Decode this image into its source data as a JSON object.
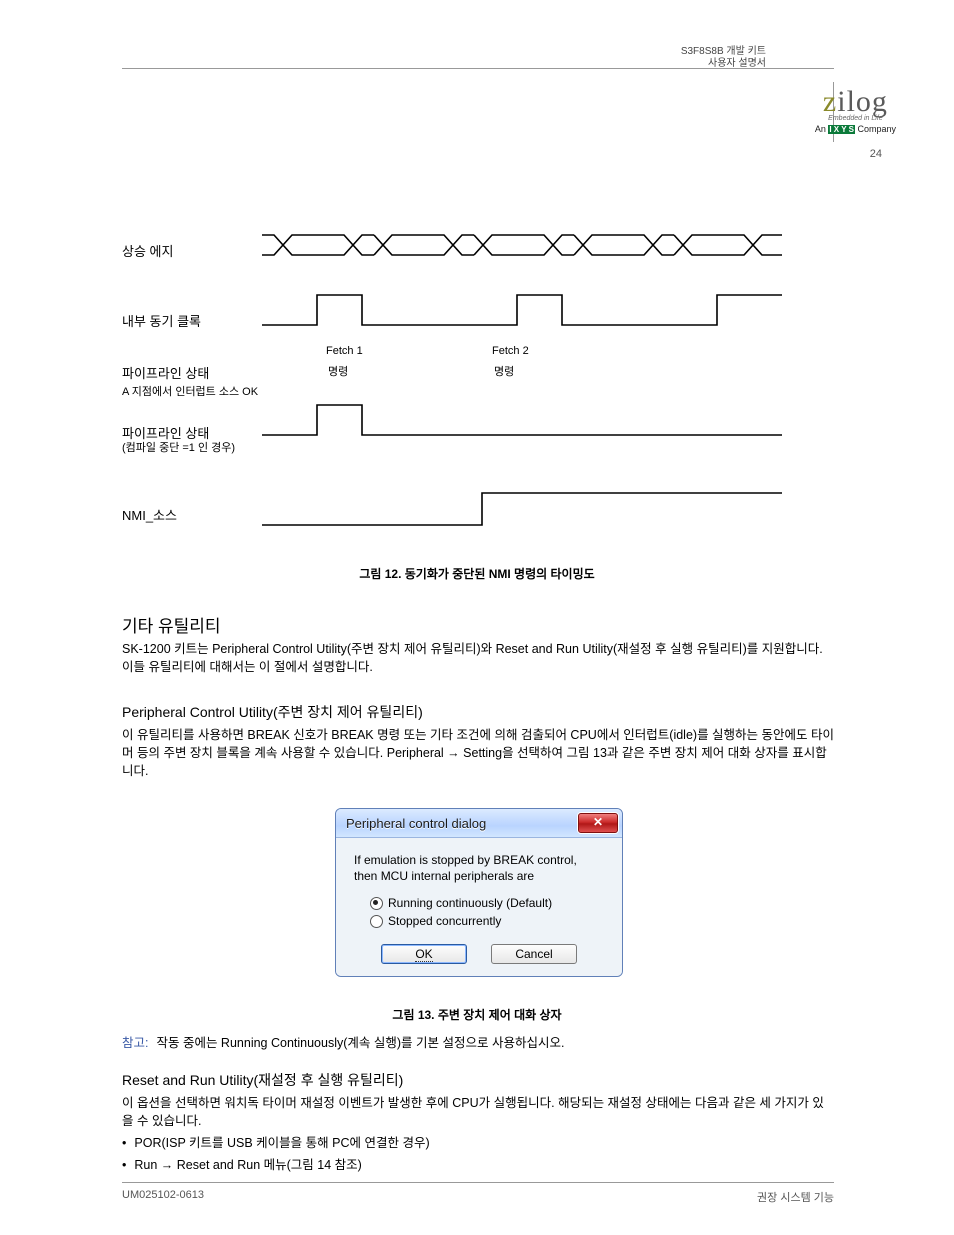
{
  "header": {
    "line1": "S3F8S8B 개발 키트",
    "line2": "사용자 설명서",
    "page": "24"
  },
  "logo": {
    "brand_z": "z",
    "brand_rest": "ilog",
    "sub1": "Embedded in Life",
    "sub2_pre": "An ",
    "sub2_ix": "I X Y S",
    "sub2_post": " Company"
  },
  "timing": {
    "row1": "상승 에지",
    "row2": "내부 동기 클록",
    "row3_a": "Fetch 1",
    "row3_b": "Fetch 2",
    "row4": "파이프라인 상태",
    "row4_a": "명령",
    "row4_b": "명령",
    "row5": "A 지점에서 인터럽트 소스 OK",
    "row6": "파이프라인 상태",
    "row6_note": "(컴파일 중단 =1 인 경우)",
    "row7": "NMI_소스",
    "fig12_cap": "그림 12. 동기화가 중단된 NMI 명령의 타이밍도"
  },
  "sections": {
    "s1_title": "기타 유틸리티",
    "s1_body": "SK-1200 키트는 Peripheral Control Utility(주변 장치 제어 유틸리티)와 Reset and Run Utility(재설정 후 실행 유틸리티)를 지원합니다. 이들 유틸리티에 대해서는 이 절에서 설명합니다.",
    "s2_title": "Peripheral Control Utility(주변 장치 제어 유틸리티)",
    "s2_body": "이 유틸리티를 사용하면 BREAK 신호가 BREAK 명령 또는 기타 조건에 의해 검출되어 CPU에서 인터럽트(idle)를 실행하는 동안에도 타이머 등의 주변 장치 블록을 계속 사용할 수 있습니다. Peripheral → Setting을 선택하여 그림 13과 같은 주변 장치 제어 대화 상자를 표시합니다.",
    "fig13_cap": "그림 13. 주변 장치 제어 대화 상자",
    "s3_title": "Reset and Run Utility(재설정 후 실행 유틸리티)",
    "s3_body1": "이 옵션을 선택하면 워치독 타이머 재설정 이벤트가 발생한 후에 CPU가 실행됩니다. 해당되는 재설정 상태에는 다음과 같은 세 가지가 있을 수 있습니다.",
    "s3_li1": "POR(ISP 키트를 USB 케이블을 통해 PC에 연결한 경우)",
    "s3_li2": "Run → Reset and Run 메뉴(그림 14 참조)",
    "note_label": "참고:",
    "note_body": "작동 중에는 Running Continuously(계속 실행)를 기본 설정으로 사용하십시오."
  },
  "dialog": {
    "title": "Peripheral control dialog",
    "msg1": "If emulation is stopped by BREAK control,",
    "msg2": "then MCU internal peripherals are",
    "opt1": "Running continuously (Default)",
    "opt2": "Stopped concurrently",
    "ok": "OK",
    "cancel": "Cancel"
  },
  "footer": {
    "left": "UM025102-0613",
    "right": "권장 시스템 기능"
  }
}
